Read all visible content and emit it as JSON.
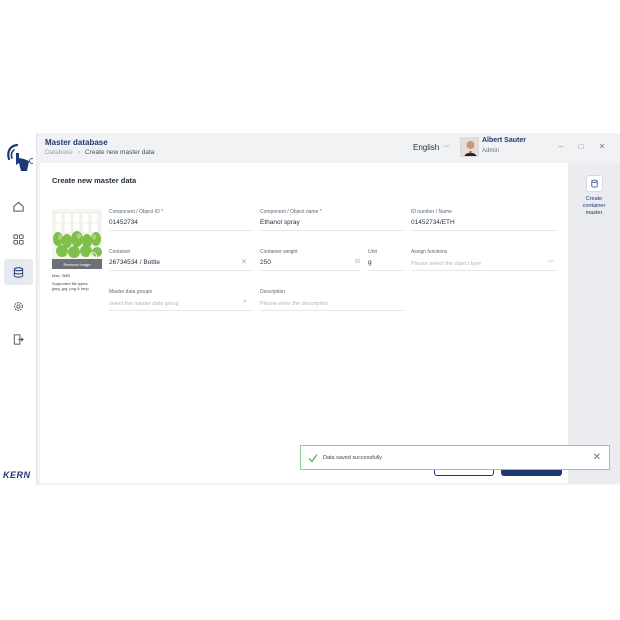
{
  "header": {
    "title": "Master database",
    "breadcrumb": [
      "Database",
      "Create new master data"
    ],
    "language": "English",
    "user_name": "Albert Sauter",
    "user_role": "Admin",
    "window_controls": [
      "–",
      "□",
      "✕"
    ]
  },
  "sidebar": {
    "brand": "KERN",
    "items": [
      "home-icon",
      "grid-icon",
      "database-icon",
      "gear-icon",
      "logout-icon"
    ],
    "active_index": 2
  },
  "form": {
    "title": "Create new master data",
    "remove_image_label": "Remove image",
    "image_note_max": "Max: 2MB",
    "image_note_types": "Supported file types:",
    "image_note_ext": "jpeg, jpg, png & bmp",
    "component_id_label": "Component / Object ID *",
    "component_id_value": "01452734",
    "component_name_label": "Component / Object name *",
    "component_name_value": "Ethanol spray",
    "id_number_label": "ID number / Name",
    "id_number_value": "01452734/ETH",
    "container_label": "Container",
    "container_value": "26734534 / Bottle",
    "container_weight_label": "Container weight",
    "container_weight_value": "250",
    "unit_label": "Unit",
    "unit_value": "g",
    "assign_functions_label": "Assign functions",
    "assign_functions_placeholder": "Please select the object type",
    "master_groups_label": "Master data groups",
    "master_groups_placeholder": "select the master data group",
    "description_label": "Description",
    "description_placeholder": "Please enter the description"
  },
  "side_panel": {
    "action_label_1": "Create",
    "action_label_2": "container",
    "action_label_3": "master"
  },
  "toast": {
    "message": "Data saved successfully",
    "status_color": "#4caf50"
  },
  "colors": {
    "brand": "#1b3a73",
    "success_border": "#8fcf8a"
  }
}
